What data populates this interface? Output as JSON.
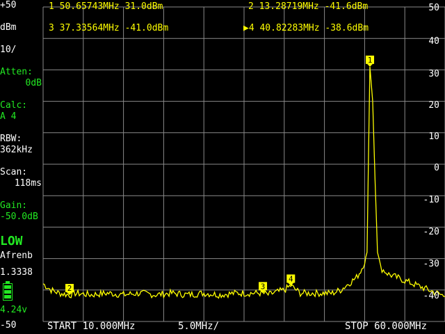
{
  "sidebar": {
    "ref_level": "+50",
    "unit": "dBm",
    "scale": "10/",
    "atten_label": "Atten:",
    "atten_value": "0dB",
    "calc_label": "Calc:",
    "calc_value": "A 4",
    "rbw_label": "RBW:",
    "rbw_value": "362kHz",
    "scan_label": "Scan:",
    "scan_value": "118ms",
    "gain_label": "Gain:",
    "gain_value": "-50.0dB",
    "mode": "LOW",
    "mode_sub": "Afrenb",
    "version": "1.3338",
    "battery_voltage": "4.24v",
    "bottom_level": "-50"
  },
  "markers": [
    {
      "num": "1",
      "text": "1 50.65743MHz 31.0dBm"
    },
    {
      "num": "2",
      "text": "2 13.28719MHz -41.6dBm"
    },
    {
      "num": "3",
      "text": "3 37.33564MHz -41.0dBm"
    },
    {
      "num": "4",
      "text": "4 40.82283MHz -38.6dBm",
      "active": true
    }
  ],
  "footer": {
    "start": "START 10.000MHz",
    "per_div": "5.0MHz/",
    "stop": "STOP 60.000MHz"
  },
  "chart_data": {
    "type": "line",
    "x_range_mhz": [
      10,
      60
    ],
    "ylim": [
      -50,
      50
    ],
    "y_ticks": [
      50,
      40,
      30,
      20,
      10,
      0,
      -10,
      -20,
      -30,
      -40
    ],
    "grid": true,
    "series": [
      {
        "color": "#ffff00",
        "x": [
          10,
          11,
          12,
          13.3,
          14,
          16,
          18,
          20,
          22,
          24,
          26,
          28,
          30,
          32,
          34,
          36,
          37.3,
          38,
          40,
          40.8,
          42,
          44,
          46,
          47,
          48,
          48.5,
          49,
          49.5,
          50,
          50.3,
          50.66,
          51,
          51.3,
          51.6,
          52,
          53,
          54,
          56,
          58,
          60
        ],
        "y": [
          -38,
          -40,
          -41,
          -41.6,
          -41,
          -41.5,
          -41,
          -41.5,
          -41,
          -41.5,
          -41,
          -41.5,
          -41,
          -41.5,
          -41,
          -41,
          -41,
          -41.5,
          -40,
          -38.6,
          -41,
          -41,
          -41,
          -40,
          -38,
          -37,
          -36,
          -34,
          -31,
          -28,
          31,
          20,
          -5,
          -28,
          -33,
          -35,
          -36,
          -38,
          -40,
          -42
        ]
      }
    ],
    "marker_points": [
      {
        "num": "1",
        "x": 50.66,
        "y": 31.0
      },
      {
        "num": "2",
        "x": 13.29,
        "y": -41.6
      },
      {
        "num": "3",
        "x": 37.34,
        "y": -41.0
      },
      {
        "num": "4",
        "x": 40.82,
        "y": -38.6
      }
    ]
  }
}
